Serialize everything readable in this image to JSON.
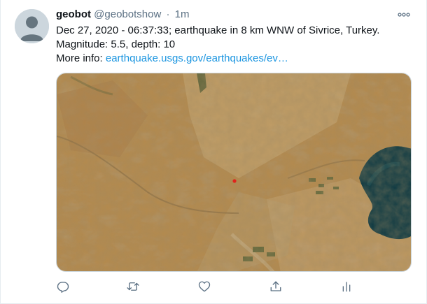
{
  "tweet": {
    "author_name": "geobot",
    "author_handle": "@geobotshow",
    "separator": "·",
    "time": "1m",
    "text_line1": "Dec 27, 2020 - 06:37:33; earthquake in 8 km WNW of Sivrice, Turkey.",
    "text_line2": "Magnitude: 5.5, depth: 10",
    "text_line3_prefix": "More info: ",
    "link_text": "earthquake.usgs.gov/earthquakes/ev…"
  },
  "media": {
    "description_icon": "satellite-map-image",
    "epicenter_color": "#e0231b",
    "lake_color": "#0e3a43",
    "terrain_color": "#b48a4e"
  },
  "icons": {
    "more": "more-horizontal-icon",
    "reply": "reply-icon",
    "retweet": "retweet-icon",
    "like": "heart-icon",
    "share": "share-icon",
    "analytics": "analytics-icon"
  }
}
